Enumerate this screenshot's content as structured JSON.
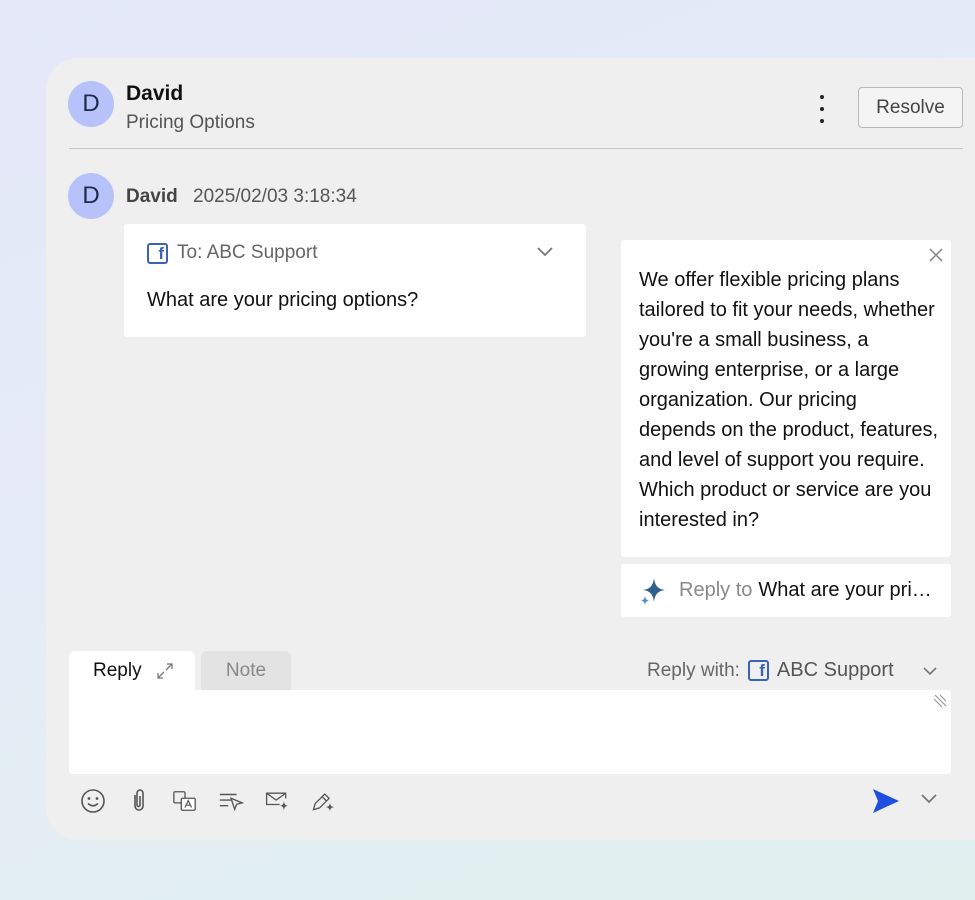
{
  "header": {
    "avatar_initial": "D",
    "name": "David",
    "subject": "Pricing Options",
    "more_icon": "kebab-vertical-icon",
    "resolve_label": "Resolve"
  },
  "message": {
    "avatar_initial": "D",
    "sender": "David",
    "timestamp": "2025/02/03 3:18:34",
    "channel_icon": "facebook-icon",
    "to_label": "To: ABC Support",
    "text": "What are your pricing options?"
  },
  "ai_suggestion": {
    "text": "We offer flexible pricing plans tailored to fit your needs, whether you're a small business, a growing enterprise, or a large organization. Our pricing depends on the product, features, and level of support you require. Which product or service are you interested in?",
    "reply_prefix": "Reply to",
    "reply_quote": "What are your pri…",
    "sparkle_color": "#2f5f8a"
  },
  "composer": {
    "tab_reply": "Reply",
    "tab_note": "Note",
    "reply_with_label": "Reply with:",
    "reply_with_value": "ABC Support",
    "toolbar_icons": [
      "emoji-icon",
      "attachment-icon",
      "translate-icon",
      "template-icon",
      "ai-mail-icon",
      "ai-edit-icon"
    ],
    "send_color": "#1f4fe0"
  }
}
